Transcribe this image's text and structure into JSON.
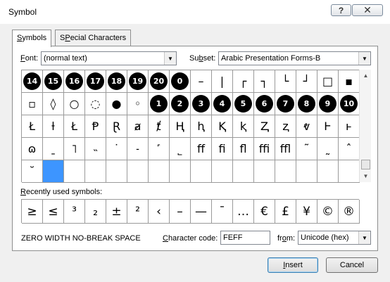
{
  "window": {
    "title": "Symbol",
    "help_label": "?",
    "close_label": "✕"
  },
  "tabs": [
    {
      "label": "Symbols",
      "accel": "S",
      "rest": "ymbols"
    },
    {
      "label": "Special Characters",
      "accel": "P",
      "pre": "S",
      "rest": "ecial Characters"
    }
  ],
  "font": {
    "label_accel": "F",
    "label_rest": "ont:",
    "value": "(normal text)"
  },
  "subset": {
    "label_pre": "Su",
    "label_accel": "b",
    "label_rest": "set:",
    "value": "Arabic Presentation Forms-B"
  },
  "symbol_grid": [
    [
      "14",
      "15",
      "16",
      "17",
      "18",
      "19",
      "20",
      "0",
      "–",
      "|",
      "┌",
      "┐",
      "└",
      "┘",
      "□",
      "▪"
    ],
    [
      "▫",
      "◊",
      "○",
      "◌",
      "●",
      "◦",
      "1",
      "2",
      "3",
      "4",
      "5",
      "6",
      "7",
      "8",
      "9",
      "10"
    ],
    [
      "Ł",
      "ƚ",
      "Ł",
      "Ᵽ",
      "Ɽ",
      "ⱥ",
      "ⱦ",
      "Ⱨ",
      "ⱨ",
      "Ⱪ",
      "ⱪ",
      "Ⱬ",
      "ⱬ",
      "ⱴ",
      "Ⱶ",
      "ⱶ"
    ],
    [
      "ɷ",
      "ˍ",
      "˥",
      "˵",
      "˙",
      "˗",
      "˹",
      "˾",
      "ﬀ",
      "ﬁ",
      "ﬂ",
      "ﬃ",
      "ﬄ",
      "˜",
      "˷",
      "ˆ"
    ],
    [
      "˘",
      "",
      "",
      "",
      "",
      "",
      "",
      "",
      "",
      "",
      "",
      "",
      "",
      "",
      "",
      ""
    ]
  ],
  "circled_cells": [
    [
      0,
      0
    ],
    [
      0,
      1
    ],
    [
      0,
      2
    ],
    [
      0,
      3
    ],
    [
      0,
      4
    ],
    [
      0,
      5
    ],
    [
      0,
      6
    ],
    [
      0,
      7
    ],
    [
      1,
      6
    ],
    [
      1,
      7
    ],
    [
      1,
      8
    ],
    [
      1,
      9
    ],
    [
      1,
      10
    ],
    [
      1,
      11
    ],
    [
      1,
      12
    ],
    [
      1,
      13
    ],
    [
      1,
      14
    ],
    [
      1,
      15
    ]
  ],
  "selected_cell": [
    4,
    1
  ],
  "recent": {
    "label_accel": "R",
    "label_rest": "ecently used symbols:",
    "symbols": [
      "≥",
      "≤",
      "³",
      "₂",
      "±",
      "²",
      "‹",
      "–",
      "—",
      "¯",
      "…",
      "€",
      "£",
      "¥",
      "©",
      "®"
    ]
  },
  "char_name": "ZERO WIDTH NO-BREAK SPACE",
  "char_code": {
    "label_accel": "C",
    "label_rest": "haracter code:",
    "value": "FEFF"
  },
  "from": {
    "label_pre": "fr",
    "label_accel": "o",
    "label_rest": "m:",
    "value": "Unicode (hex)"
  },
  "buttons": {
    "insert_accel": "I",
    "insert_rest": "nsert",
    "cancel": "Cancel"
  }
}
